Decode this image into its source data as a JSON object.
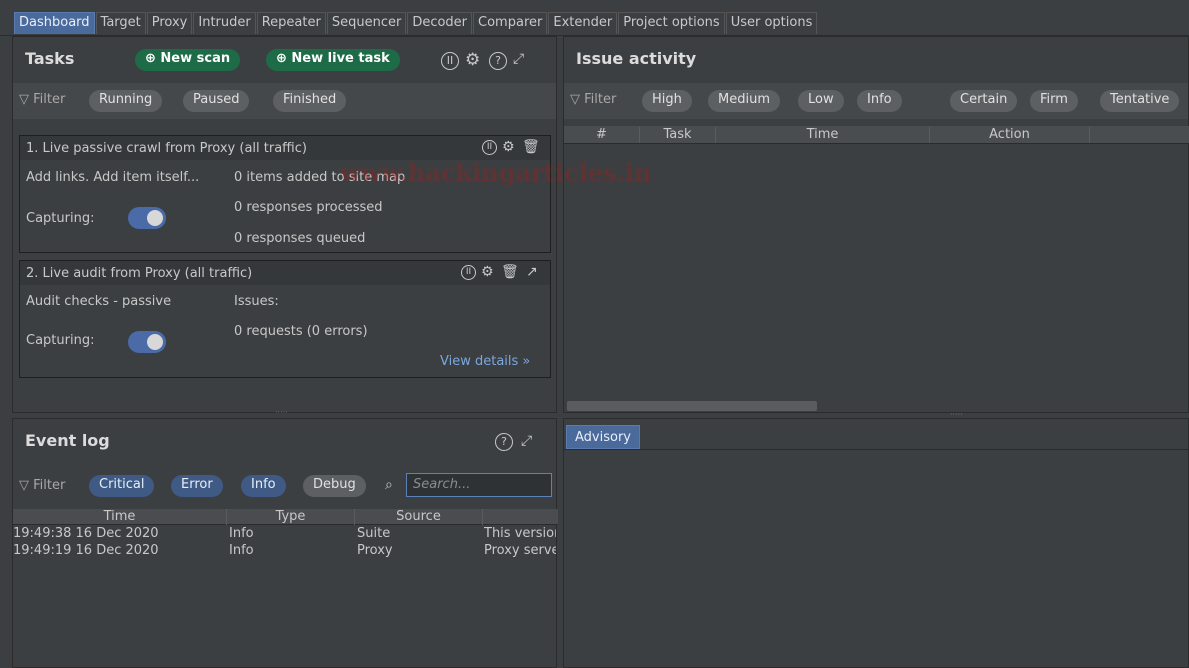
{
  "tabs": [
    "Dashboard",
    "Target",
    "Proxy",
    "Intruder",
    "Repeater",
    "Sequencer",
    "Decoder",
    "Comparer",
    "Extender",
    "Project options",
    "User options"
  ],
  "tasks_panel": {
    "title": "Tasks",
    "new_scan": "New scan",
    "new_live_task": "New live task",
    "filter_label": "Filter",
    "filters": [
      "Running",
      "Paused",
      "Finished"
    ],
    "task1": {
      "title": "1. Live passive crawl from Proxy (all traffic)",
      "desc": "Add links. Add item itself...",
      "capturing_label": "Capturing:",
      "stats": [
        "0 items added to site map",
        "0 responses processed",
        "0 responses queued"
      ]
    },
    "task2": {
      "title": "2. Live audit from Proxy (all traffic)",
      "desc": "Audit checks - passive",
      "capturing_label": "Capturing:",
      "issues_label": "Issues:",
      "requests": "0 requests (0 errors)",
      "view_details": "View details »"
    }
  },
  "issues_panel": {
    "title": "Issue activity",
    "filter_label": "Filter",
    "severity_filters": [
      "High",
      "Medium",
      "Low",
      "Info"
    ],
    "confidence_filters": [
      "Certain",
      "Firm",
      "Tentative"
    ],
    "columns": [
      "#",
      "Task",
      "Time",
      "Action"
    ]
  },
  "event_log": {
    "title": "Event log",
    "filter_label": "Filter",
    "filters": [
      "Critical",
      "Error",
      "Info",
      "Debug"
    ],
    "search_placeholder": "Search...",
    "columns": [
      "Time",
      "Type",
      "Source"
    ],
    "rows": [
      {
        "time": "19:49:38 16 Dec 2020",
        "type": "Info",
        "source": "Suite",
        "message": "This version"
      },
      {
        "time": "19:49:19 16 Dec 2020",
        "type": "Info",
        "source": "Proxy",
        "message": "Proxy server"
      }
    ]
  },
  "advisory_tab": "Advisory",
  "watermark": "www.hackingarticles.in"
}
